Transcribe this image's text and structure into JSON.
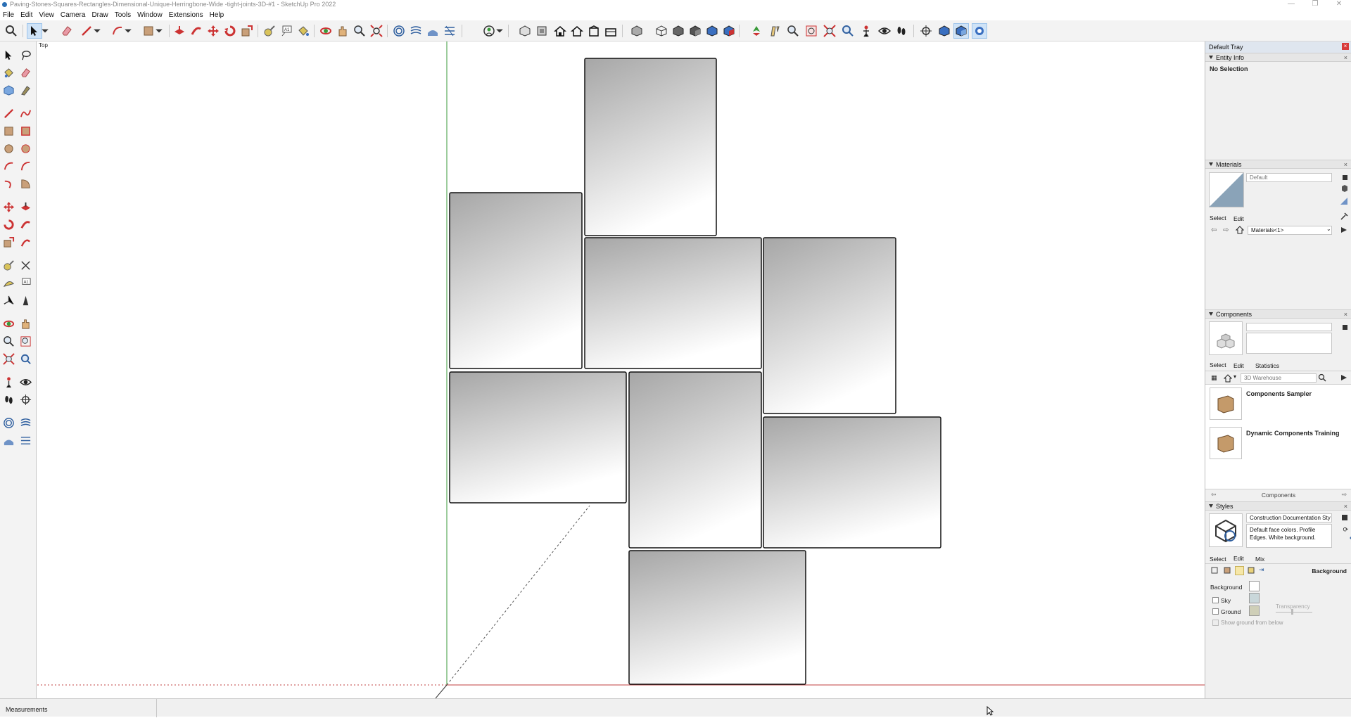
{
  "window": {
    "title": "Paving-Stones-Squares-Rectangles-Dimensional-Unique-Herringbone-Wide -tight-joints-3D-#1 - SketchUp Pro 2022",
    "minimize": "—",
    "maximize": "❐",
    "close": "✕"
  },
  "menu": [
    "File",
    "Edit",
    "View",
    "Camera",
    "Draw",
    "Tools",
    "Window",
    "Extensions",
    "Help"
  ],
  "viewport": {
    "scene_label": "Top"
  },
  "tray": {
    "title": "Default Tray",
    "close": "×",
    "entity_info": {
      "header": "Entity Info",
      "value": "No Selection"
    },
    "materials": {
      "header": "Materials",
      "name_field": "Default",
      "tabs": [
        "Select",
        "Edit"
      ],
      "library": "Materials<1>"
    },
    "components": {
      "header": "Components",
      "tabs": [
        "Select",
        "Edit",
        "Statistics"
      ],
      "search_placeholder": "3D Warehouse",
      "items": [
        "Components Sampler",
        "Dynamic Components Training"
      ],
      "footer": "Components"
    },
    "styles": {
      "header": "Styles",
      "style_name": "Construction Documentation Sty",
      "description": "Default face colors. Profile Edges. White background.",
      "tabs": [
        "Select",
        "Edit",
        "Mix"
      ],
      "section": "Background",
      "background_label": "Background",
      "sky_label": "Sky",
      "ground_label": "Ground",
      "transparency_label": "Transparency",
      "show_ground_label": "Show ground from below",
      "colors": {
        "background": "#ffffff",
        "sky": "#c9d7da",
        "ground": "#cfcfb8"
      }
    }
  },
  "status": {
    "measurements_label": "Measurements"
  },
  "colors": {
    "accent": "#cfe3f7",
    "axis_green": "#3a9a3a",
    "axis_red": "#c04040"
  }
}
